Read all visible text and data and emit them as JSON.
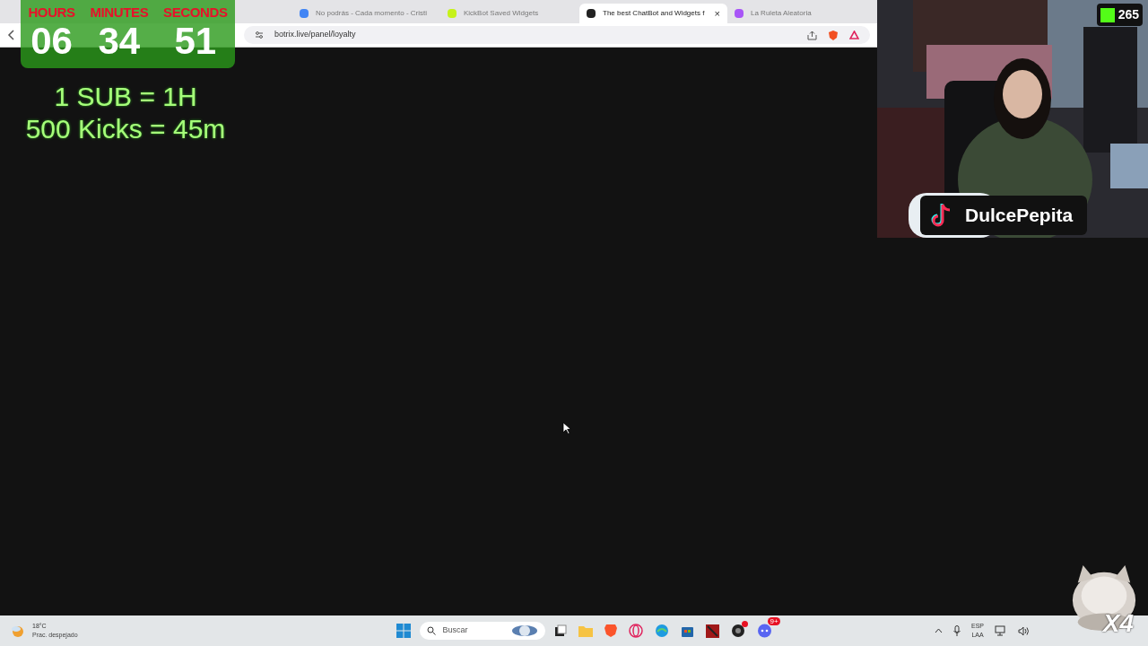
{
  "browser": {
    "tabs": [
      {
        "title": "No podrás - Cada momento - Cristi",
        "selected": false,
        "color": "#4285f4"
      },
      {
        "title": "KickBot Saved Widgets",
        "selected": false,
        "color": "#c6f21a"
      },
      {
        "title": "The best ChatBot and Widgets f",
        "selected": true,
        "color": "#222222"
      },
      {
        "title": "La Ruleta Aleatoria",
        "selected": false,
        "color": "#a855f7"
      }
    ],
    "close": "×",
    "url": "botrix.live/panel/loyalty"
  },
  "timer": {
    "units": [
      {
        "label": "HOURS",
        "value": "06"
      },
      {
        "label": "MINUTES",
        "value": "34"
      },
      {
        "label": "SECONDS",
        "value": "51"
      }
    ]
  },
  "rules": [
    "1 SUB = 1H",
    "500 Kicks = 45m"
  ],
  "stream": {
    "kick_count": "265",
    "tiktok_name": "DulcePepita",
    "multiplier": "X4"
  },
  "taskbar": {
    "temp": "18°C",
    "condition": "Prac. despejado",
    "search_placeholder": "Buscar",
    "notification_badge": "9+",
    "language": [
      "ESP",
      "LAA"
    ]
  }
}
